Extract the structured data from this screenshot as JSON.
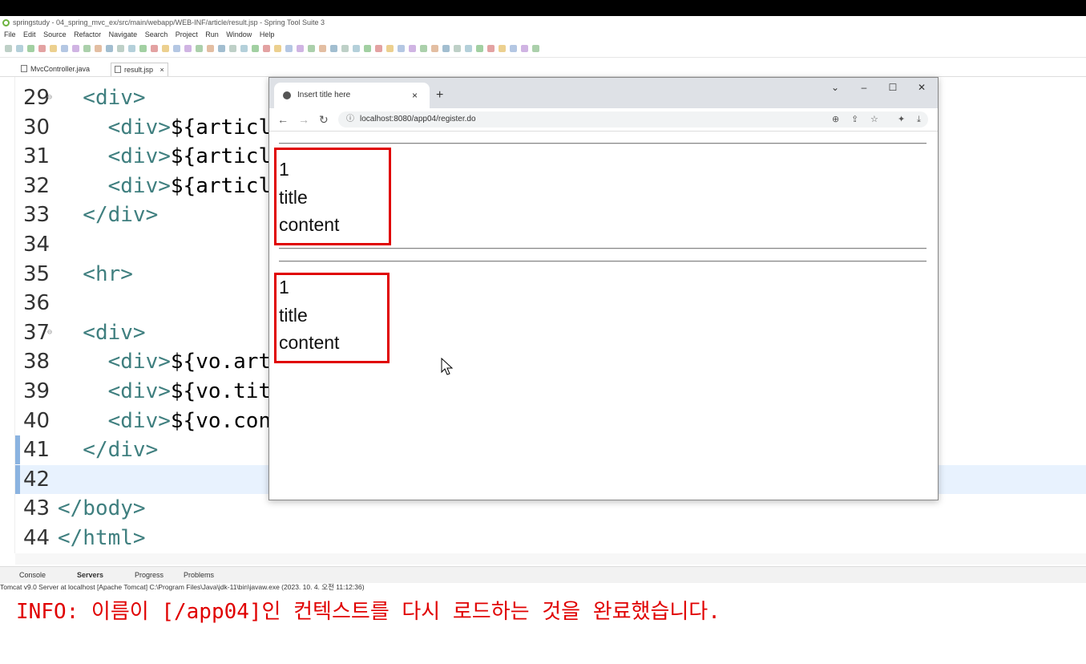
{
  "ide": {
    "title": "springstudy - 04_spring_mvc_ex/src/main/webapp/WEB-INF/article/result.jsp - Spring Tool Suite 3",
    "menu": [
      "File",
      "Edit",
      "Source",
      "Refactor",
      "Navigate",
      "Search",
      "Project",
      "Run",
      "Window",
      "Help"
    ],
    "tabs": [
      {
        "label": "MvcController.java"
      },
      {
        "label": "result.jsp"
      }
    ],
    "close_glyph": "×"
  },
  "editor": {
    "lines": [
      {
        "num": "29",
        "fold": true,
        "code": "  <div>"
      },
      {
        "num": "30",
        "fold": false,
        "code": "    <div>${articl"
      },
      {
        "num": "31",
        "fold": false,
        "code": "    <div>${articl"
      },
      {
        "num": "32",
        "fold": false,
        "code": "    <div>${articl"
      },
      {
        "num": "33",
        "fold": false,
        "code": "  </div>"
      },
      {
        "num": "34",
        "fold": false,
        "code": ""
      },
      {
        "num": "35",
        "fold": false,
        "code": "  <hr>"
      },
      {
        "num": "36",
        "fold": false,
        "code": ""
      },
      {
        "num": "37",
        "fold": true,
        "code": "  <div>"
      },
      {
        "num": "38",
        "fold": false,
        "code": "    <div>${vo.art"
      },
      {
        "num": "39",
        "fold": false,
        "code": "    <div>${vo.tit"
      },
      {
        "num": "40",
        "fold": false,
        "code": "    <div>${vo.con"
      },
      {
        "num": "41",
        "fold": false,
        "code": "  </div>"
      },
      {
        "num": "42",
        "fold": false,
        "code": ""
      },
      {
        "num": "43",
        "fold": false,
        "code": "</body>"
      },
      {
        "num": "44",
        "fold": false,
        "code": "</html>"
      }
    ]
  },
  "console": {
    "tabs": [
      "Console",
      "Servers",
      "Progress",
      "Problems"
    ],
    "info": "Tomcat v9.0 Server at localhost [Apache Tomcat] C:\\Program Files\\Java\\jdk-11\\bin\\javaw.exe  (2023. 10. 4. 오전 11:12:36)",
    "output": "INFO: 이름이 [/app04]인 컨텍스트를 다시 로드하는 것을 완료했습니다."
  },
  "browser": {
    "tab_title": "Insert title here",
    "tab_close": "×",
    "new_tab": "+",
    "url": "localhost:8080/app04/register.do",
    "win_controls": [
      "⌄",
      "–",
      "☐",
      "✕"
    ],
    "blocks": [
      {
        "lines": [
          "1",
          "title",
          "content"
        ]
      },
      {
        "lines": [
          "1",
          "title",
          "content"
        ]
      }
    ]
  },
  "colors": {
    "highlight_box": "#e00000",
    "console_output": "#e00000",
    "code_tag": "#3f7f7f",
    "current_line": "#e8f2fe"
  }
}
